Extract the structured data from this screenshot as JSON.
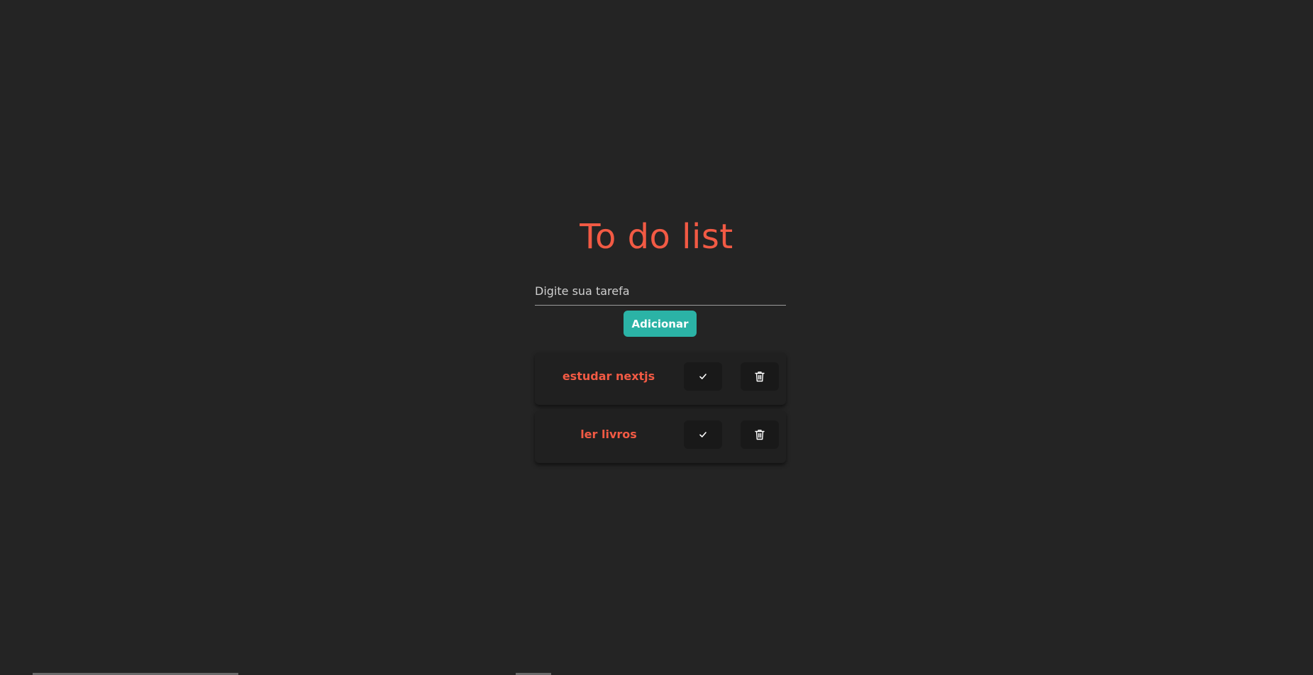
{
  "app": {
    "title": "To do list"
  },
  "form": {
    "input_placeholder": "Digite sua tarefa",
    "input_value": "",
    "add_label": "Adicionar"
  },
  "tasks": [
    {
      "label": "estudar nextjs",
      "check_icon": "check-icon",
      "delete_icon": "trash-icon"
    },
    {
      "label": "ler livros",
      "check_icon": "check-icon",
      "delete_icon": "trash-icon"
    }
  ],
  "colors": {
    "background": "#242424",
    "accent": "#f25a44",
    "button": "#2bb3a6",
    "card": "#202020"
  }
}
